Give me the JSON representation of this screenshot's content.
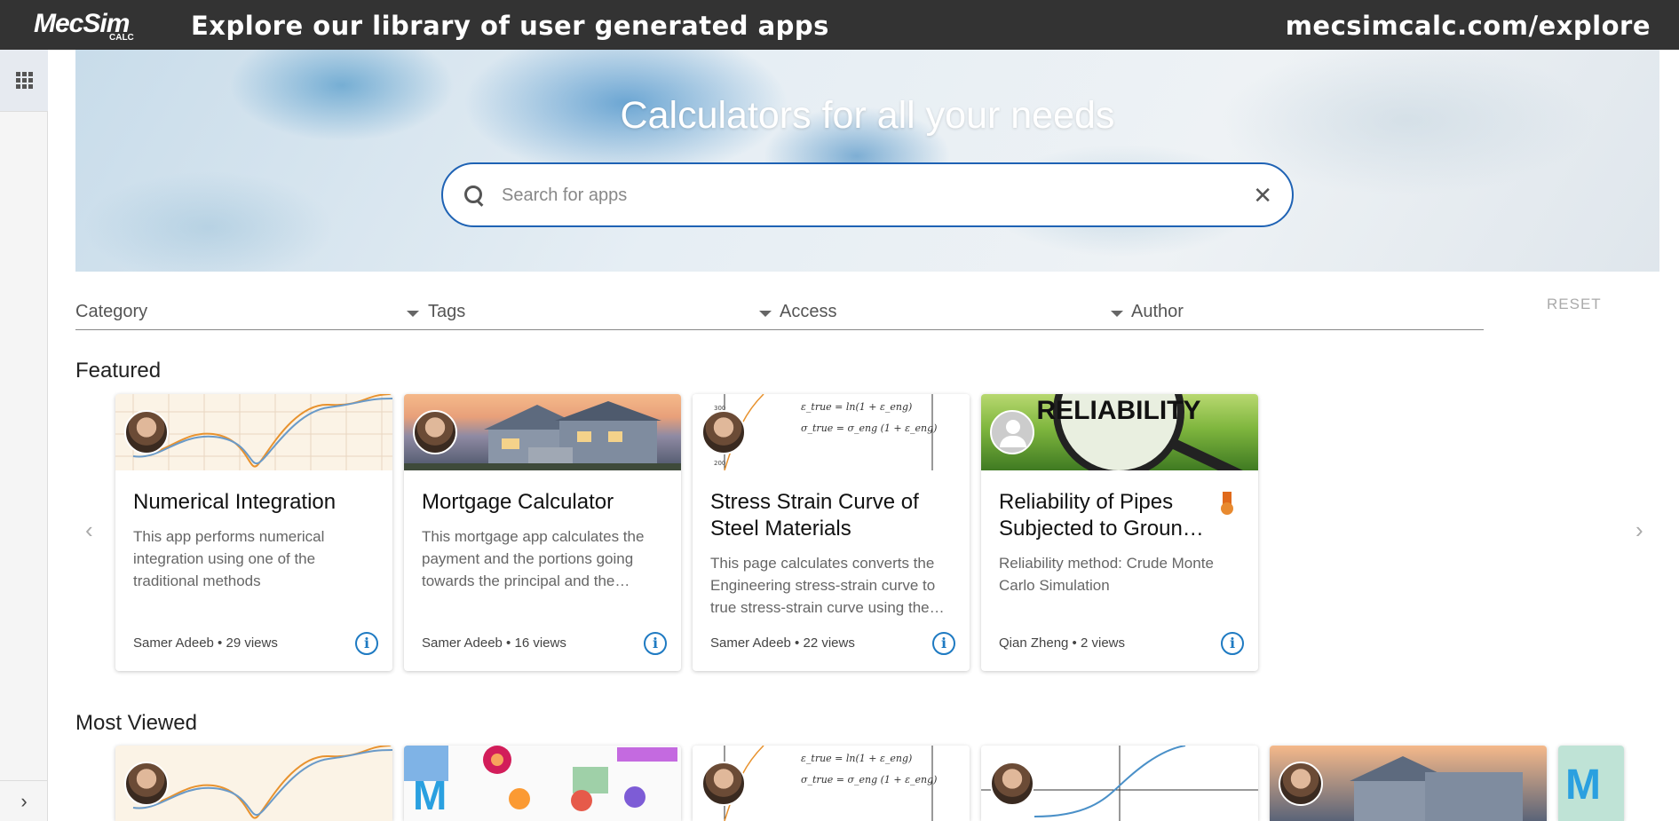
{
  "header": {
    "logo_main": "MecSim",
    "logo_sub": "CALC",
    "headline": "Explore our library of user generated apps",
    "url": "mecsimcalc.com/explore"
  },
  "sidebar": {
    "apps_icon": "grid-icon",
    "expand_icon": "chevron-right-icon"
  },
  "hero": {
    "title": "Calculators for all your needs",
    "search_placeholder": "Search for apps",
    "search_value": ""
  },
  "filters": {
    "items": [
      {
        "label": "Category"
      },
      {
        "label": "Tags"
      },
      {
        "label": "Access"
      },
      {
        "label": "Author"
      }
    ],
    "reset_label": "RESET"
  },
  "sections": {
    "featured_title": "Featured",
    "most_viewed_title": "Most Viewed"
  },
  "featured": [
    {
      "title": "Numerical Integration",
      "description": "This app performs numerical integration using one of the traditional methods",
      "author": "Samer Adeeb",
      "views": "29 views",
      "meta": "Samer Adeeb • 29 views"
    },
    {
      "title": "Mortgage Calculator",
      "description": "This mortgage app calculates the payment and the portions going towards the principal and the…",
      "author": "Samer Adeeb",
      "views": "16 views",
      "meta": "Samer Adeeb • 16 views"
    },
    {
      "title": "Stress Strain Curve of Steel Materials",
      "description": "This page calculates converts the Engineering stress-strain curve to true stress-strain curve using the…",
      "author": "Samer Adeeb",
      "views": "22 views",
      "meta": "Samer Adeeb • 22 views"
    },
    {
      "title": "Reliability of Pipes Subjected to Groun…",
      "description": "Reliability method: Crude Monte Carlo Simulation",
      "author": "Qian Zheng",
      "views": "2 views",
      "meta": "Qian Zheng • 2 views",
      "thumb_text": "RELIABILITY"
    }
  ],
  "thumbs": {
    "eq1": "ε_true = ln(1 + ε_eng)",
    "eq2": "σ_true = σ_eng (1 + ε_eng)",
    "tick_300": "300",
    "tick_200": "200"
  },
  "colors": {
    "accent": "#1e62b4",
    "info": "#1e7ac2",
    "topbar": "#333333",
    "badge": "#e06a1b"
  }
}
